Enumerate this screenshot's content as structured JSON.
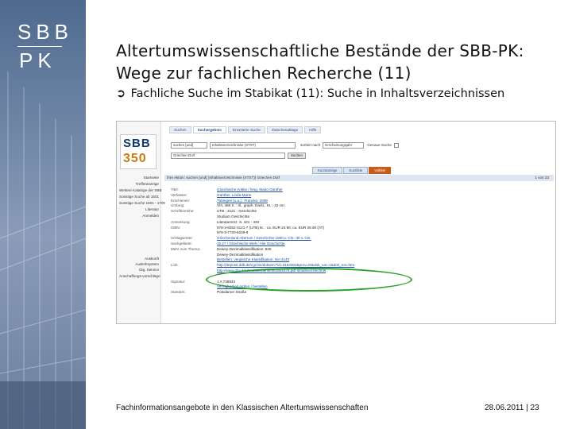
{
  "brand": {
    "logo_top": "SBB",
    "logo_bottom": "PK"
  },
  "slide": {
    "title_line1": "Altertumswissenschaftliche Bestände der SBB-PK:",
    "title_line2": "Wege zur fachlichen Recherche (11)",
    "subtitle_arrow": "➲",
    "subtitle": "Fachliche Suche im Stabikat (11): Suche in Inhaltsverzeichnissen"
  },
  "screenshot": {
    "logo_top": "SBB",
    "logo_bottom": "350",
    "tabs": [
      "Suchen",
      "Suchergebnis",
      "Erweiterte Suche",
      "Zwischenablage",
      "Hilfe"
    ],
    "nav": [
      "Startseite",
      "Trefferanzeige",
      "Weitere Kataloge der SBB",
      "Sonstige Suche ab 1501",
      "Sonstige Suche 1501 - 1700",
      "Literatur",
      "Anmelden"
    ],
    "nav2": [
      "Auskunft",
      "Ausleihsystem",
      "Dig. Service",
      "Anschaffungs-vorschläge"
    ],
    "search": {
      "field1": "suchen [und]",
      "field2": "Inhaltsverzeichnisse (XTXT)",
      "sort_label": "sortiert nach",
      "sort_value": "Erscheinungsjahr",
      "exact": "Genaue Suche",
      "query": "Griechen Dorf",
      "submit": "Suchen"
    },
    "result_tabs": [
      "Kurzanzeige",
      "Kurzliste",
      "Volltitel"
    ],
    "result_bar": {
      "text": "Ihre Aktion: suchen [und] (Inhaltsverzeichnisse (XTXT)) Griechen Dorf",
      "count": "1 von 23"
    },
    "record": [
      {
        "label": "Titel:",
        "value": "Griechische Antike / hrsg. Mario Günther",
        "link": true
      },
      {
        "label": "Verfasser:",
        "value": "Günther, Linda-Marie",
        "link": true
      },
      {
        "label": "Erschienen:",
        "value": "Tübingen [u.a.] : Francke, 2008",
        "link": true
      },
      {
        "label": "Umfang:",
        "value": "VIII, 468 S. : Ill., graph. Darst., Kt. ; 22 cm",
        "link": false
      },
      {
        "label": "Schriftenreihe:",
        "value": "UTB ; 3121 : Geschichte",
        "link": false
      },
      {
        "label": "",
        "value": "Studium Geschichte",
        "link": false
      },
      {
        "label": "Anmerkung:",
        "value": "Literaturverz. S. 421 - 433",
        "link": false
      },
      {
        "label": "ISBN:",
        "value": "978-3-8252-3121-7 (UTB) kt. : ca. EUR 24.90, ca. EUR 25.60 (AT)",
        "link": false
      },
      {
        "label": "",
        "value": "978-3-7720-8229-9",
        "link": false
      },
      {
        "label": "Schlagwörter:",
        "value": "Griechenland Altertum / Geschichte 1600 v. Chr.-30 v. Chr.",
        "link": true
      },
      {
        "label": "Sachgebiete:",
        "value": "15.27 / Griechische Welt / Alte Geschichte",
        "link": true
      },
      {
        "label": "Mehr zum Thema:",
        "value": "Dewey-Dezimalklassifikation: 930",
        "link": false
      },
      {
        "label": "",
        "value": "Dewey-Dezimalklassifikation",
        "link": false
      },
      {
        "label": "",
        "value": "Bestellen: vergleiche Klassifikation: NH 4140",
        "link": true
      },
      {
        "label": "Link:",
        "value": "http://deposit.ddb.de/cgi-bin/dokserv?id=3153362&prov=M&dok_var=1&dok_ext=htm",
        "link": true
      },
      {
        "label": "",
        "value": "http://www.gbv.de/dms/sbb-berlin/561951675.pdf  Inhaltsverzeichnis",
        "link": true
      },
      {
        "label": "",
        "value": "",
        "link": false
      },
      {
        "label": "Signatur:",
        "value": "1 A 736934",
        "link": false
      },
      {
        "label": "",
        "value": "Verfügbarkeit prüfen / bestellen",
        "link": true
      },
      {
        "label": "Standort:",
        "value": "Potsdamer Straße",
        "link": false
      }
    ]
  },
  "footer": {
    "left": "Fachinformationsangebote in den Klassischen Altertumswissenschaften",
    "right": "28.06.2011 | 23"
  }
}
